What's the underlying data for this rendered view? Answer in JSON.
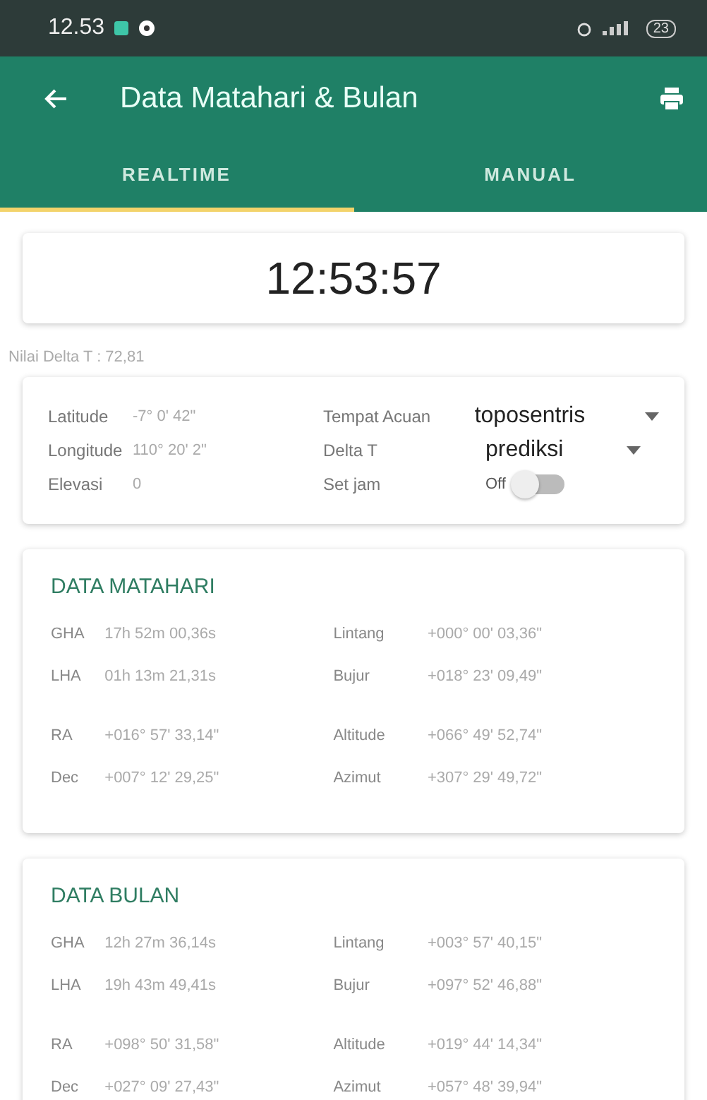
{
  "status_bar": {
    "time": "12.53",
    "battery": "23"
  },
  "app_bar": {
    "title": "Data Matahari & Bulan"
  },
  "tabs": [
    {
      "label": "REALTIME",
      "selected": true
    },
    {
      "label": "MANUAL",
      "selected": false
    }
  ],
  "clock": "12:53:57",
  "delta_t_note": "Nilai Delta T : 72,81",
  "settings": {
    "left": [
      {
        "label": "Latitude",
        "value": "-7° 0' 42\""
      },
      {
        "label": "Longitude",
        "value": "110° 20' 2\""
      },
      {
        "label": "Elevasi",
        "value": "0"
      }
    ],
    "right": [
      {
        "kind": "dropdown",
        "label": "Tempat Acuan",
        "value": "toposentris"
      },
      {
        "kind": "dropdown",
        "label": "Delta T",
        "value": "prediksi"
      },
      {
        "kind": "switch",
        "label": "Set jam",
        "value": "Off",
        "on": false
      }
    ]
  },
  "sections": [
    {
      "title": "DATA MATAHARI",
      "groups": [
        [
          {
            "label": "GHA",
            "value": "17h 52m 00,36s",
            "label2": "Lintang",
            "value2": "+000° 00' 03,36\""
          },
          {
            "label": "LHA",
            "value": "01h 13m 21,31s",
            "label2": "Bujur",
            "value2": "+018° 23' 09,49\""
          }
        ],
        [
          {
            "label": "RA",
            "value": "+016° 57' 33,14\"",
            "label2": "Altitude",
            "value2": "+066° 49' 52,74\""
          },
          {
            "label": "Dec",
            "value": "+007° 12' 29,25\"",
            "label2": "Azimut",
            "value2": "+307° 29' 49,72\""
          }
        ]
      ]
    },
    {
      "title": "DATA BULAN",
      "groups": [
        [
          {
            "label": "GHA",
            "value": "12h 27m 36,14s",
            "label2": "Lintang",
            "value2": "+003° 57' 40,15\""
          },
          {
            "label": "LHA",
            "value": "19h 43m 49,41s",
            "label2": "Bujur",
            "value2": "+097° 52' 46,88\""
          }
        ],
        [
          {
            "label": "RA",
            "value": "+098° 50' 31,58\"",
            "label2": "Altitude",
            "value2": "+019° 44' 14,34\""
          },
          {
            "label": "Dec",
            "value": "+027° 09' 27,43\"",
            "label2": "Azimut",
            "value2": "+057° 48' 39,94\""
          }
        ]
      ]
    }
  ]
}
